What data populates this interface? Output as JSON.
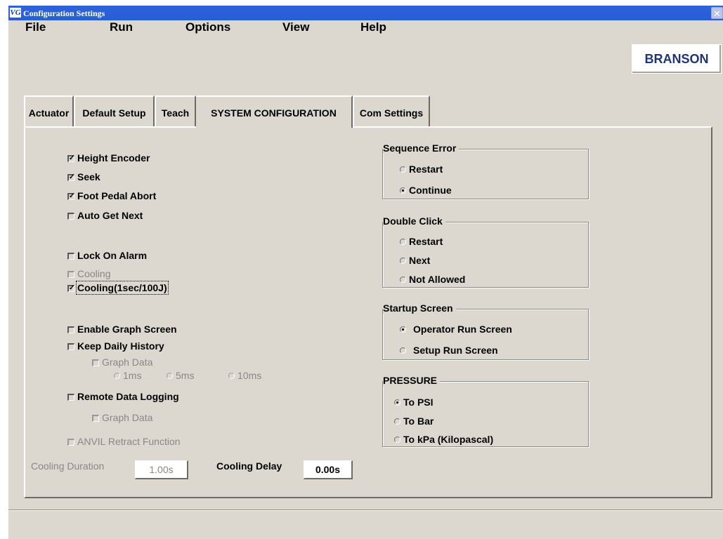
{
  "window": {
    "title": "Configuration Settings",
    "app_icon": "VG"
  },
  "menubar": {
    "file": "File",
    "run": "Run",
    "options": "Options",
    "view": "View",
    "help": "Help"
  },
  "brand": "BRANSON",
  "tabs": {
    "actuator": "Actuator",
    "default_setup": "Default Setup",
    "teach": "Teach",
    "system_configuration": "SYSTEM CONFIGURATION",
    "com_settings": "Com Settings"
  },
  "options": {
    "height_encoder": "Height Encoder",
    "seek": "Seek",
    "foot_pedal_abort": "Foot Pedal Abort",
    "auto_get_next": "Auto Get Next",
    "lock_on_alarm": "Lock On Alarm",
    "cooling": "Cooling",
    "cooling_1sec": "Cooling(1sec/100J)",
    "enable_graph_screen": "Enable Graph Screen",
    "keep_daily_history": "Keep Daily History",
    "graph_data_1": "Graph Data",
    "rate_1ms": "1ms",
    "rate_5ms": "5ms",
    "rate_10ms": "10ms",
    "remote_data_logging": "Remote Data Logging",
    "graph_data_2": "Graph Data",
    "anvil_retract": "ANVIL Retract Function"
  },
  "checked": {
    "height_encoder": true,
    "seek": true,
    "foot_pedal_abort": true,
    "auto_get_next": false,
    "lock_on_alarm": false,
    "cooling": false,
    "cooling_1sec": true,
    "enable_graph_screen": false,
    "keep_daily_history": false,
    "graph_data_1": false,
    "remote_data_logging": false,
    "graph_data_2": false,
    "anvil_retract": false
  },
  "sequence_error": {
    "legend": "Sequence Error",
    "restart": "Restart",
    "continue": "Continue",
    "selected": "continue"
  },
  "double_click": {
    "legend": "Double Click",
    "restart": "Restart",
    "next": "Next",
    "not_allowed": "Not Allowed",
    "selected": "none"
  },
  "startup_screen": {
    "legend": "Startup Screen",
    "operator_run": "Operator Run Screen",
    "setup_run": "Setup Run Screen",
    "selected": "operator_run"
  },
  "pressure": {
    "legend": "PRESSURE",
    "psi": "To PSI",
    "bar": "To Bar",
    "kpa": "To kPa (Kilopascal)",
    "selected": "psi"
  },
  "cooling": {
    "duration_label": "Cooling Duration",
    "duration_value": "1.00s",
    "delay_label": "Cooling Delay",
    "delay_value": "0.00s"
  }
}
